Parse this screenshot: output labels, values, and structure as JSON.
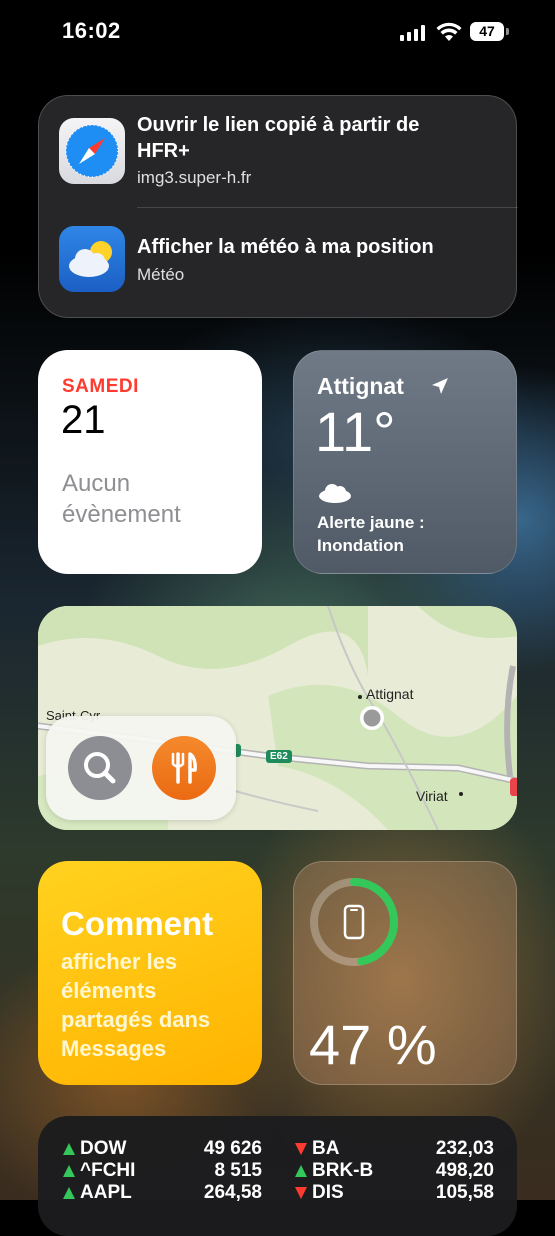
{
  "status_bar": {
    "time": "16:02",
    "battery_level": "47"
  },
  "suggestions": [
    {
      "title": "Ouvrir le lien copié à partir de HFR+",
      "subtitle": "img3.super-h.fr",
      "icon": "safari-icon"
    },
    {
      "title": "Afficher la météo à ma position",
      "subtitle": "Météo",
      "icon": "weather-app-icon"
    }
  ],
  "calendar": {
    "weekday": "SAMEDI",
    "date": "21",
    "events_text": "Aucun évènement"
  },
  "weather": {
    "city": "Attignat",
    "temperature": "11°",
    "alert": "Alerte jaune : Inondation",
    "condition_icon": "cloud-icon"
  },
  "map": {
    "labels": {
      "attignat": "Attignat",
      "saint": "Saint-Cyr",
      "viriat": "Viriat",
      "road": "E62"
    },
    "search_icon": "search-icon",
    "food_icon": "fork-knife-icon"
  },
  "tips": {
    "title": "Comment",
    "body": "afficher les éléments partagés dans Messages"
  },
  "battery_widget": {
    "percent_label": "47 %",
    "level": 0.47,
    "ring_color": "#34c759",
    "device_icon": "iphone-icon"
  },
  "stocks": {
    "left": [
      {
        "symbol": "DOW",
        "value": "49 626",
        "direction": "up"
      },
      {
        "symbol": "^FCHI",
        "value": "8 515",
        "direction": "up"
      },
      {
        "symbol": "AAPL",
        "value": "264,58",
        "direction": "up"
      }
    ],
    "right": [
      {
        "symbol": "BA",
        "value": "232,03",
        "direction": "down"
      },
      {
        "symbol": "BRK-B",
        "value": "498,20",
        "direction": "up"
      },
      {
        "symbol": "DIS",
        "value": "105,58",
        "direction": "down"
      }
    ],
    "colors": {
      "up": "#34c759",
      "down": "#ff3b30"
    }
  }
}
